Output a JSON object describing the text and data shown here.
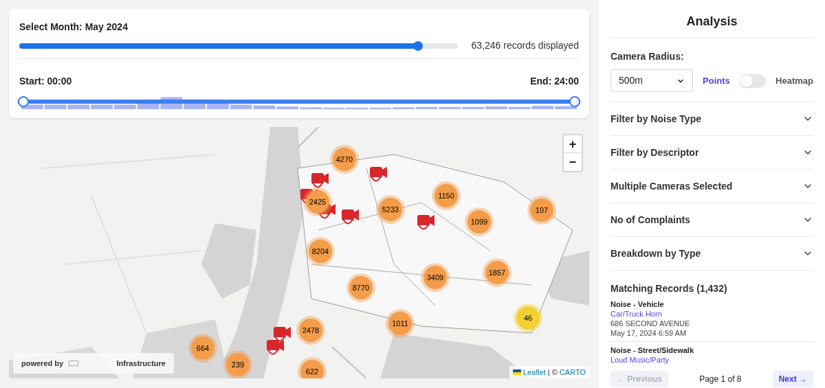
{
  "month_control": {
    "label": "Select Month: May 2024",
    "slider": {
      "level": 0.91
    },
    "records_displayed": "63,246 records displayed"
  },
  "time_control": {
    "start_label": "Start: 00:00",
    "end_label": "End: 24:00",
    "handles": [
      {
        "level": 0
      },
      {
        "level": 1
      }
    ]
  },
  "map": {
    "zoom_in": "+",
    "zoom_out": "−",
    "clusters": [
      {
        "count": "4270",
        "color": "#f39c4a"
      },
      {
        "count": "2425",
        "color": "#f39c4a"
      },
      {
        "count": "5233",
        "color": "#f39c4a"
      },
      {
        "count": "1150",
        "color": "#f39c4a"
      },
      {
        "count": "1099",
        "color": "#f39c4a"
      },
      {
        "count": "107",
        "color": "#f39c4a"
      },
      {
        "count": "8204",
        "color": "#f39c4a"
      },
      {
        "count": "3409",
        "color": "#f39c4a"
      },
      {
        "count": "1857",
        "color": "#f39c4a"
      },
      {
        "count": "8770",
        "color": "#f39c4a"
      },
      {
        "count": "1011",
        "color": "#f39c4a"
      },
      {
        "count": "46",
        "color": "#f1d033"
      },
      {
        "count": "2478",
        "color": "#f39c4a"
      },
      {
        "count": "664",
        "color": "#f39c4a"
      },
      {
        "count": "239",
        "color": "#f39c4a"
      },
      {
        "count": "622",
        "color": "#f39c4a"
      }
    ],
    "cameras": [
      {
        "kind": "camera"
      },
      {
        "kind": "camera"
      },
      {
        "kind": "camera"
      },
      {
        "kind": "camera"
      },
      {
        "kind": "camera"
      },
      {
        "kind": "camera"
      },
      {
        "kind": "camera"
      },
      {
        "kind": "camera"
      }
    ],
    "powered_by": "powered by",
    "powered_by_name": "Infrastructure",
    "attribution": {
      "leaflet": "Leaflet",
      "separator": "| ©",
      "carto": "CARTO"
    }
  },
  "sidebar": {
    "title": "Analysis",
    "radius_label": "Camera Radius:",
    "radius_value": "500m",
    "view_toggle": {
      "left": "Points",
      "right": "Heatmap",
      "on": false
    },
    "sections": [
      {
        "label": "Filter by Noise Type",
        "expanded": false
      },
      {
        "label": "Filter by Descriptor",
        "expanded": false
      },
      {
        "label": "Multiple Cameras Selected",
        "expanded": false
      },
      {
        "label": "No of Complaints",
        "expanded": false
      },
      {
        "label": "Breakdown by Type",
        "expanded": false
      }
    ],
    "records_title": "Matching Records (1,432)",
    "records": [
      {
        "type": "Noise - Vehicle",
        "descriptor": "Car/Truck Horn",
        "address": "686 SECOND AVENUE",
        "date": "May 17, 2024 6:59 AM"
      },
      {
        "type": "Noise - Street/Sidewalk",
        "descriptor": "Loud Music/Party"
      }
    ],
    "pagination": {
      "previous": "← Previous",
      "previous_disabled": true,
      "page": "Page 1 of 8",
      "next": "Next →",
      "next_disabled": false
    }
  }
}
